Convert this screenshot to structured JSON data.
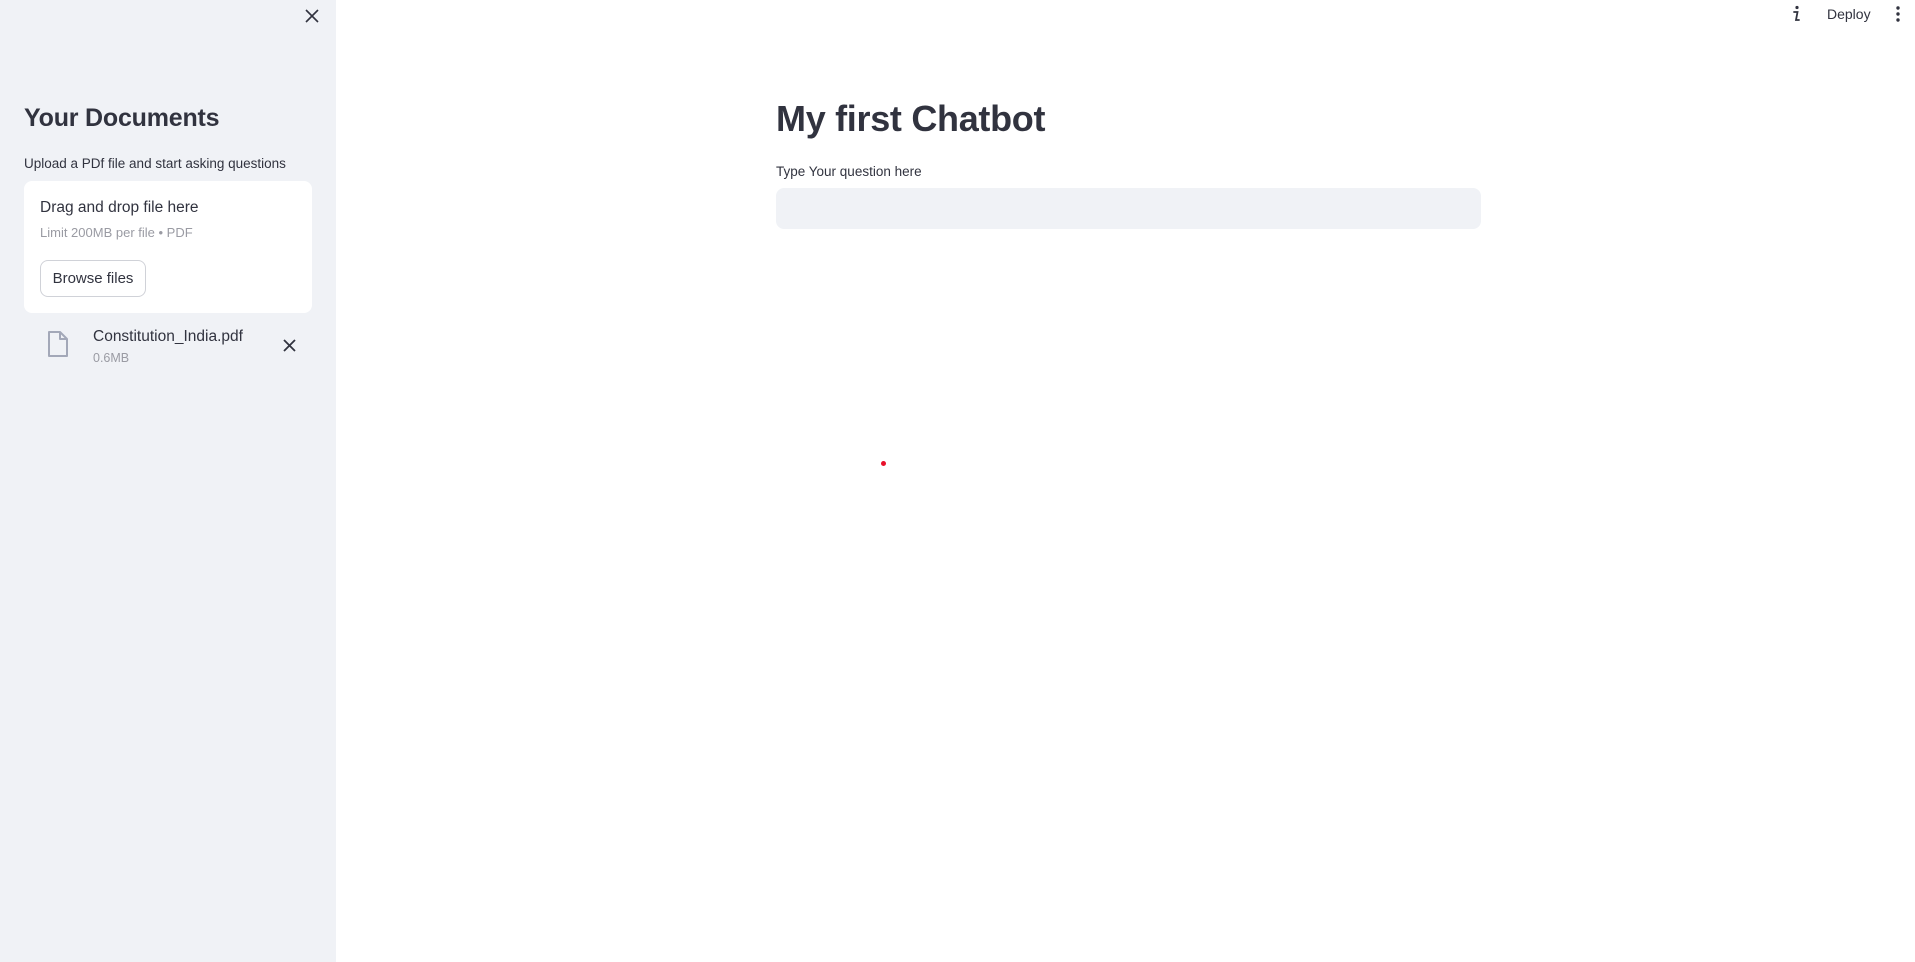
{
  "sidebar": {
    "close_icon": "close-icon",
    "title": "Your Documents",
    "subtitle": "Upload a PDf file and start asking questions",
    "uploader": {
      "dropzone_text": "Drag and drop file here",
      "limit_text": "Limit 200MB per file • PDF",
      "browse_label": "Browse files"
    },
    "uploaded_file": {
      "icon": "file-icon",
      "name": "Constitution_India.pdf",
      "size": "0.6MB",
      "remove_icon": "close-icon"
    }
  },
  "header": {
    "info_icon": "info-icon",
    "deploy_label": "Deploy",
    "menu_icon": "more-vertical-icon"
  },
  "main": {
    "title": "My first Chatbot",
    "question_label": "Type Your question here",
    "question_value": "",
    "question_placeholder": ""
  },
  "colors": {
    "sidebar_bg": "#f0f2f6",
    "text": "#31333f",
    "muted_text": "#9a9ba3",
    "input_bg": "#f0f2f6",
    "cursor_dot": "#e8102a"
  }
}
